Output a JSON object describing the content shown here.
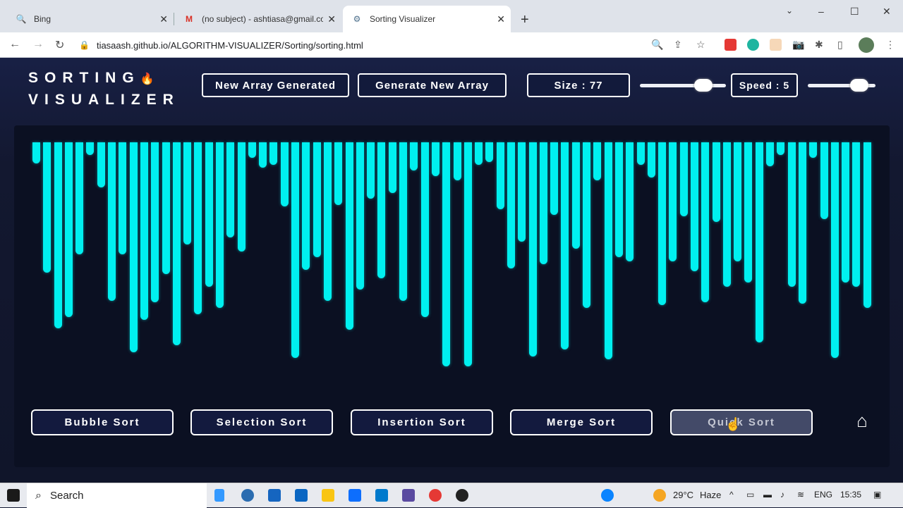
{
  "browser": {
    "tabs": [
      {
        "title": "Bing",
        "favicon": "search-icon"
      },
      {
        "title": "(no subject) - ashtiasa@gmail.co",
        "favicon": "gmail-icon"
      },
      {
        "title": "Sorting Visualizer",
        "favicon": "gear-icon"
      }
    ],
    "active_tab": 2,
    "url": "tiasaash.github.io/ALGORITHM-VISUALIZER/Sorting/sorting.html"
  },
  "app": {
    "logo_line1": "SORTING",
    "logo_line2": "VISUALIZER",
    "new_array_status": "New Array Generated",
    "generate_button": "Generate New Array",
    "size_label": "Size : 77",
    "speed_label": "Speed : 5",
    "size_slider_fraction": 0.8,
    "speed_slider_fraction": 0.85,
    "bar_color": "#00f0f0",
    "bar_heights": [
      15,
      93,
      133,
      125,
      80,
      9,
      32,
      113,
      80,
      150,
      127,
      114,
      94,
      145,
      73,
      123,
      103,
      118,
      68,
      78,
      11,
      18,
      16,
      46,
      154,
      91,
      82,
      113,
      45,
      134,
      105,
      40,
      97,
      36,
      113,
      20,
      125,
      24,
      160,
      27,
      160,
      16,
      14,
      48,
      90,
      71,
      153,
      87,
      52,
      148,
      76,
      118,
      27,
      155,
      82,
      85,
      16,
      25,
      116,
      85,
      53,
      92,
      114,
      57,
      103,
      85,
      100,
      143,
      17,
      9,
      103,
      115,
      11,
      55,
      154,
      100,
      103,
      118
    ],
    "sort_buttons": [
      "Bubble Sort",
      "Selection Sort",
      "Insertion Sort",
      "Merge Sort",
      "Quick Sort"
    ],
    "active_sort": "Quick Sort"
  },
  "taskbar": {
    "search_placeholder": "Search",
    "temperature": "29°C",
    "weather": "Haze",
    "language": "ENG",
    "time": "15:35"
  }
}
